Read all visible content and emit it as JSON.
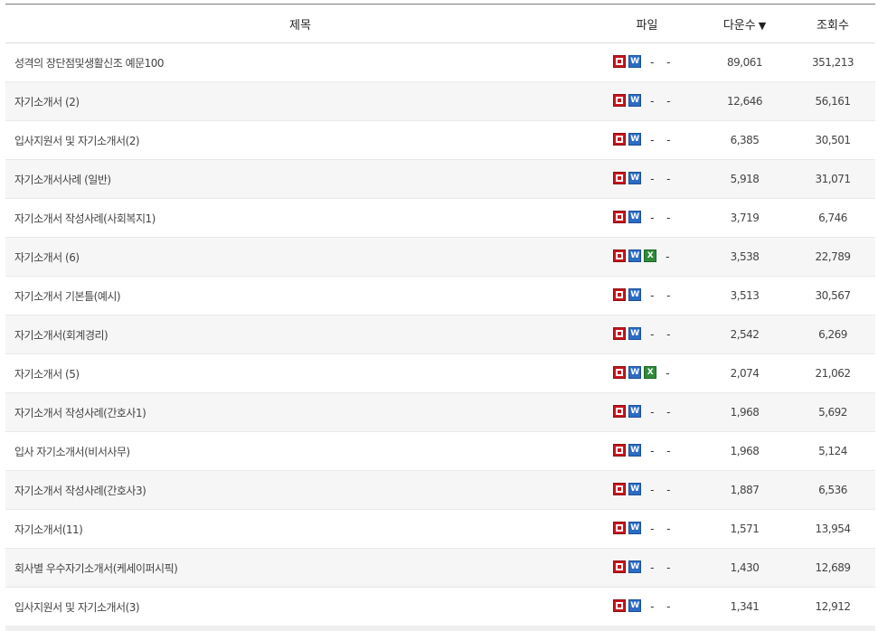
{
  "header": {
    "title_col": "제목",
    "file_col": "파일",
    "down_col": "다운수",
    "down_sort_icon": "▼",
    "view_col": "조회수"
  },
  "rows": [
    {
      "title": "성격의 장단점및생활신조 예문100",
      "files": [
        "pdf",
        "doc",
        "-",
        "-"
      ],
      "downloads": "89,061",
      "views": "351,213"
    },
    {
      "title": "자기소개서 (2)",
      "files": [
        "pdf",
        "doc",
        "-",
        "-"
      ],
      "downloads": "12,646",
      "views": "56,161"
    },
    {
      "title": "입사지원서 및 자기소개서(2)",
      "files": [
        "pdf",
        "doc",
        "-",
        "-"
      ],
      "downloads": "6,385",
      "views": "30,501"
    },
    {
      "title": "자기소개서사례 (일반)",
      "files": [
        "pdf",
        "doc",
        "-",
        "-"
      ],
      "downloads": "5,918",
      "views": "31,071"
    },
    {
      "title": "자기소개서 작성사례(사회복지1)",
      "files": [
        "pdf",
        "doc",
        "-",
        "-"
      ],
      "downloads": "3,719",
      "views": "6,746"
    },
    {
      "title": "자기소개서 (6)",
      "files": [
        "pdf",
        "doc",
        "xls",
        "-"
      ],
      "downloads": "3,538",
      "views": "22,789"
    },
    {
      "title": "자기소개서 기본틀(예시)",
      "files": [
        "pdf",
        "doc",
        "-",
        "-"
      ],
      "downloads": "3,513",
      "views": "30,567"
    },
    {
      "title": "자기소개서(회계경리)",
      "files": [
        "pdf",
        "doc",
        "-",
        "-"
      ],
      "downloads": "2,542",
      "views": "6,269"
    },
    {
      "title": "자기소개서 (5)",
      "files": [
        "pdf",
        "doc",
        "xls",
        "-"
      ],
      "downloads": "2,074",
      "views": "21,062"
    },
    {
      "title": "자기소개서 작성사례(간호사1)",
      "files": [
        "pdf",
        "doc",
        "-",
        "-"
      ],
      "downloads": "1,968",
      "views": "5,692"
    },
    {
      "title": "입사 자기소개서(비서사무)",
      "files": [
        "pdf",
        "doc",
        "-",
        "-"
      ],
      "downloads": "1,968",
      "views": "5,124"
    },
    {
      "title": "자기소개서 작성사례(간호사3)",
      "files": [
        "pdf",
        "doc",
        "-",
        "-"
      ],
      "downloads": "1,887",
      "views": "6,536"
    },
    {
      "title": "자기소개서(11)",
      "files": [
        "pdf",
        "doc",
        "-",
        "-"
      ],
      "downloads": "1,571",
      "views": "13,954"
    },
    {
      "title": "회사별 우수자기소개서(케세이퍼시픽)",
      "files": [
        "pdf",
        "doc",
        "-",
        "-"
      ],
      "downloads": "1,430",
      "views": "12,689"
    },
    {
      "title": "입사지원서 및 자기소개서(3)",
      "files": [
        "pdf",
        "doc",
        "-",
        "-"
      ],
      "downloads": "1,341",
      "views": "12,912"
    }
  ],
  "icons": {
    "pdf": "pdf-file-icon",
    "doc": "word-file-icon",
    "xls": "excel-file-icon",
    "doc_letter": "W",
    "xls_letter": "X",
    "dash": "-"
  },
  "colors": {
    "pdf": "#c8161d",
    "doc": "#2b6cc4",
    "xls": "#2e8b3a",
    "alt_row": "#f6f6f6"
  }
}
